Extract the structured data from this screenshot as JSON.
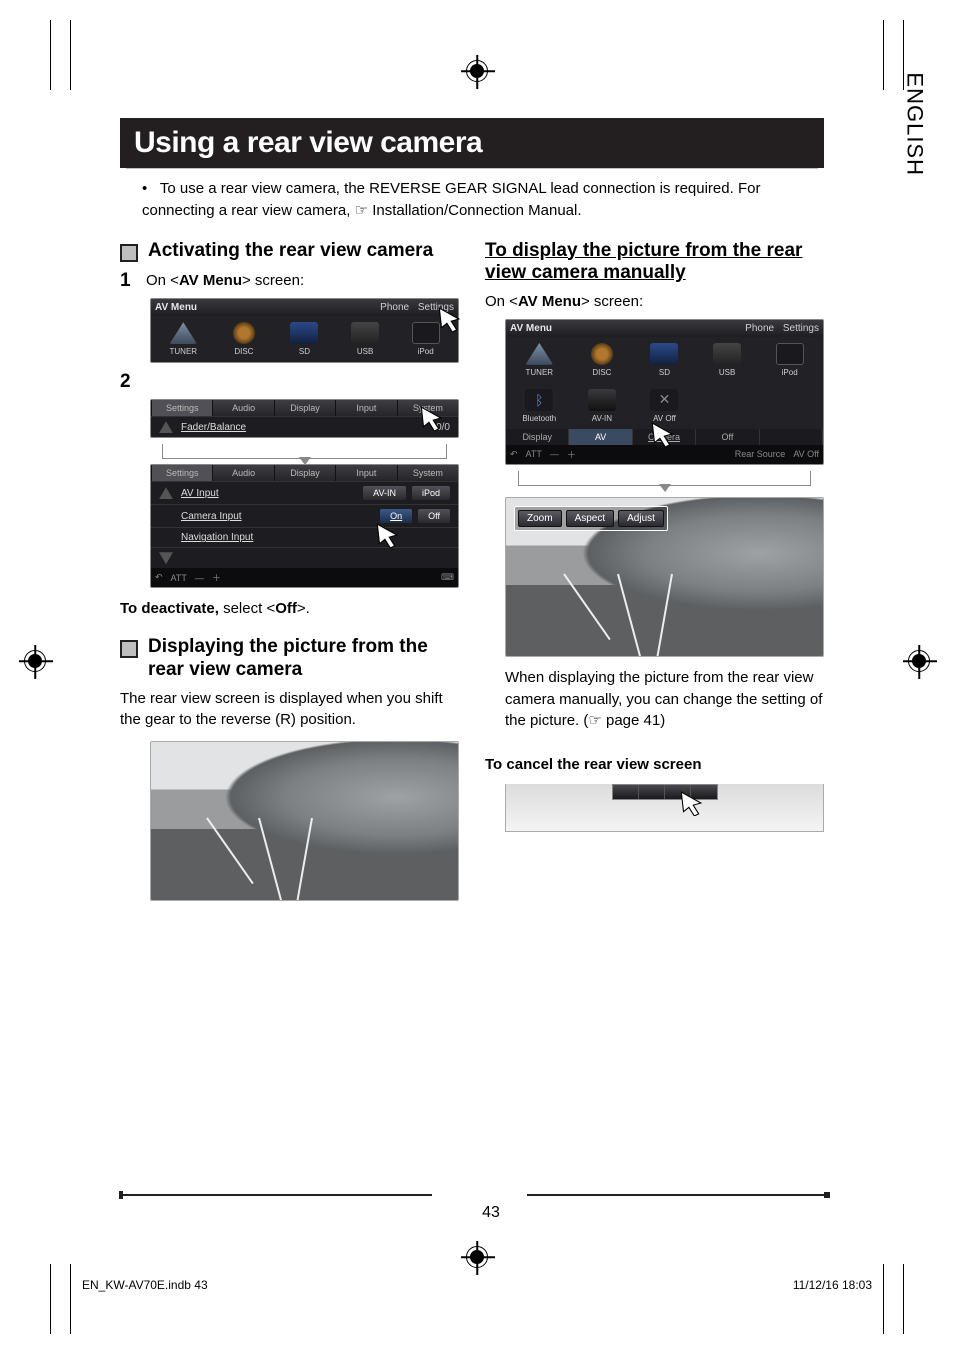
{
  "meta": {
    "language_tab": "ENGLISH",
    "page_number": "43",
    "footer_file": "EN_KW-AV70E.indb   43",
    "footer_time": "11/12/16   18:03"
  },
  "title": "Using a rear view camera",
  "intro": {
    "text_before": "To use a rear view camera, the REVERSE GEAR SIGNAL lead connection is required. For connecting a rear view camera, ",
    "text_after": " Installation/Connection Manual."
  },
  "left": {
    "activate_heading": "Activating the rear view camera",
    "step1_num": "1",
    "step1_pre": "On <",
    "step1_bold": "AV Menu",
    "step1_post": "> screen:",
    "step2_num": "2",
    "deactivate_pre": "To deactivate,",
    "deactivate_mid": " select <",
    "deactivate_bold": "Off",
    "deactivate_post": ">.",
    "display_heading": "Displaying the picture from the rear view camera",
    "display_body": "The rear view screen is displayed when you shift the gear to the reverse (R) position.",
    "av_menu": {
      "title": "AV Menu",
      "phone": "Phone",
      "settings": "Settings",
      "tuner": "TUNER",
      "disc": "DISC",
      "sd": "SD",
      "usb": "USB",
      "ipod": "iPod"
    },
    "settings1": {
      "title": "Settings",
      "tab_audio": "Audio",
      "tab_display": "Display",
      "tab_input": "Input",
      "tab_system": "System",
      "row_label": "Fader/Balance",
      "row_val": "0/0"
    },
    "settings2": {
      "title": "Settings",
      "tab_audio": "Audio",
      "tab_display": "Display",
      "tab_input": "Input",
      "tab_system": "System",
      "av_input": "AV Input",
      "avin": "AV-IN",
      "ipod": "iPod",
      "camera_input": "Camera Input",
      "on": "On",
      "off": "Off",
      "nav_input": "Navigation Input",
      "att": "ATT"
    }
  },
  "right": {
    "manual_heading": "To display the picture from the rear view camera manually",
    "manual_pre": "On <",
    "manual_bold": "AV Menu",
    "manual_post": "> screen:",
    "av_menu": {
      "title": "AV Menu",
      "phone": "Phone",
      "settings": "Settings",
      "tuner": "TUNER",
      "disc": "DISC",
      "sd": "SD",
      "usb": "USB",
      "ipod": "iPod",
      "bluetooth": "Bluetooth",
      "avin": "AV-IN",
      "avoff": "AV Off",
      "bar_display": "Display",
      "bar_av": "AV",
      "bar_camera": "Camera",
      "bar_off": "Off",
      "rear_source": "Rear Source",
      "foot_avoff": "AV Off",
      "att": "ATT"
    },
    "pills": {
      "zoom": "Zoom",
      "aspect": "Aspect",
      "adjust": "Adjust"
    },
    "manual_note_1": "When displaying the picture from the rear view camera manually, you can change the setting of the picture. (",
    "manual_note_2": " page 41)",
    "cancel_heading": "To cancel the rear view screen"
  }
}
